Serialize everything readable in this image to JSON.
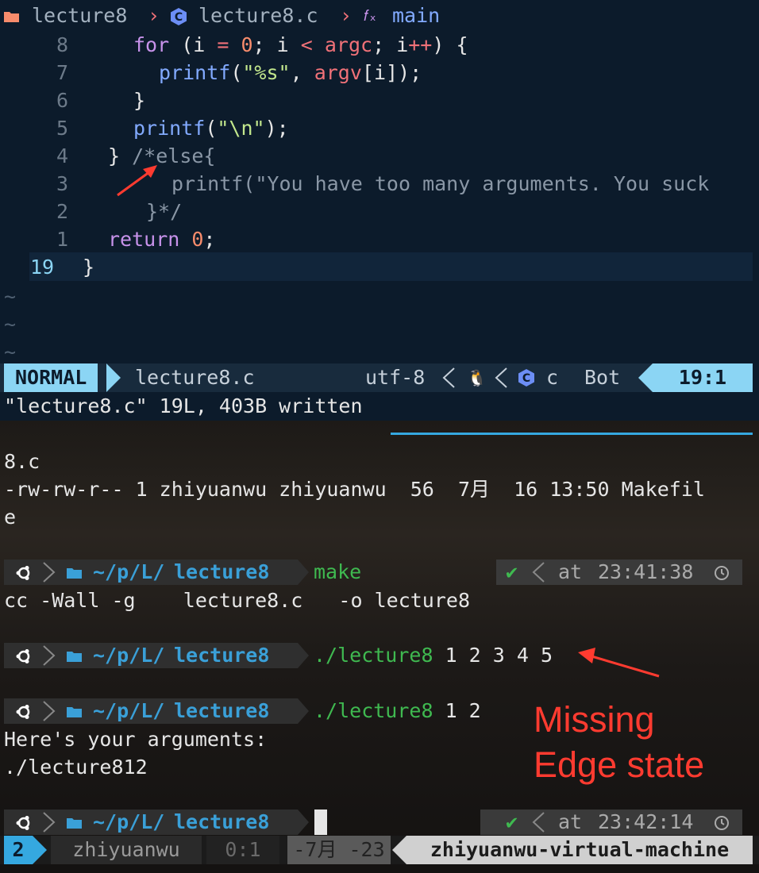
{
  "vim": {
    "breadcrumb": {
      "folder": "lecture8",
      "sep": "›",
      "file": "lecture8.c",
      "fn_icon": "𝑓ₓ",
      "fn": "main"
    },
    "lines": [
      {
        "num": "8"
      },
      {
        "num": "7"
      },
      {
        "num": "6"
      },
      {
        "num": "5"
      },
      {
        "num": "4"
      },
      {
        "num": "3"
      },
      {
        "num": "2"
      },
      {
        "num": "1"
      },
      {
        "num": "19"
      }
    ],
    "code": {
      "l8_for": "for",
      "l8_open": " (i ",
      "l8_eq": "=",
      "l8_zero": " 0",
      "l8_mid": "; i ",
      "l8_lt": "<",
      "l8_argc": " argc",
      "l8_rest": "; i",
      "l8_pp": "++",
      "l8_end": ") {",
      "l7_printf": "printf",
      "l7_open": "(",
      "l7_str": "\"%s\"",
      "l7_comma": ", ",
      "l7_argv": "argv",
      "l7_rest": "[i]);",
      "l6": "}",
      "l5_printf": "printf",
      "l5_open": "(",
      "l5_str": "\"\\n\"",
      "l5_rest": ");",
      "l4_brace": "} ",
      "l4_comment": "/*else{",
      "l3_comment": "printf(\"You have too many arguments. You suck",
      "l2_comment": "}*/",
      "l1_return": "return",
      "l1_zero": " 0",
      "l1_rest": ";",
      "l19": "}"
    },
    "tilde": "~",
    "status": {
      "mode": "NORMAL",
      "file": "lecture8.c",
      "encoding": "utf-8",
      "os_icon": "🐧",
      "ft_icon": "c-icon",
      "filetype": "c",
      "position_word": "Bot",
      "cursor": "19:1"
    },
    "message": "\"lecture8.c\" 19L, 403B written"
  },
  "shell": {
    "output_top": [
      "8.c",
      "-rw-rw-r-- 1 zhiyuanwu zhiyuanwu  56  7月  16 13:50 Makefil",
      "e"
    ],
    "prompts": [
      {
        "path_prefix": "~/p/L/",
        "dir": "lecture8",
        "cmd": "make",
        "status": "✔",
        "at": "at",
        "time": "23:41:38"
      },
      {
        "path_prefix": "~/p/L/",
        "dir": "lecture8",
        "cmd": "./lecture8",
        "args": " 1 2 3 4 5"
      },
      {
        "path_prefix": "~/p/L/",
        "dir": "lecture8",
        "cmd": "./lecture8",
        "args": " 1 2"
      },
      {
        "path_prefix": "~/p/L/",
        "dir": "lecture8",
        "cmd": "",
        "status": "✔",
        "at": "at",
        "time": "23:42:14"
      }
    ],
    "make_output": "cc -Wall -g    lecture8.c   -o lecture8",
    "run_output": [
      "Here's your arguments:",
      "./lecture812"
    ],
    "annotation": [
      "Missing",
      "Edge state"
    ]
  },
  "tmux": {
    "window": "2",
    "user": "zhiyuanwu",
    "pane": "0:1",
    "date": "-7月 -23",
    "host": "zhiyuanwu-virtual-machine"
  },
  "colors": {
    "accent": "#8bd5f4",
    "bg": "#0c1b2b",
    "annotation": "#ff3b30",
    "green": "#3fb950"
  }
}
